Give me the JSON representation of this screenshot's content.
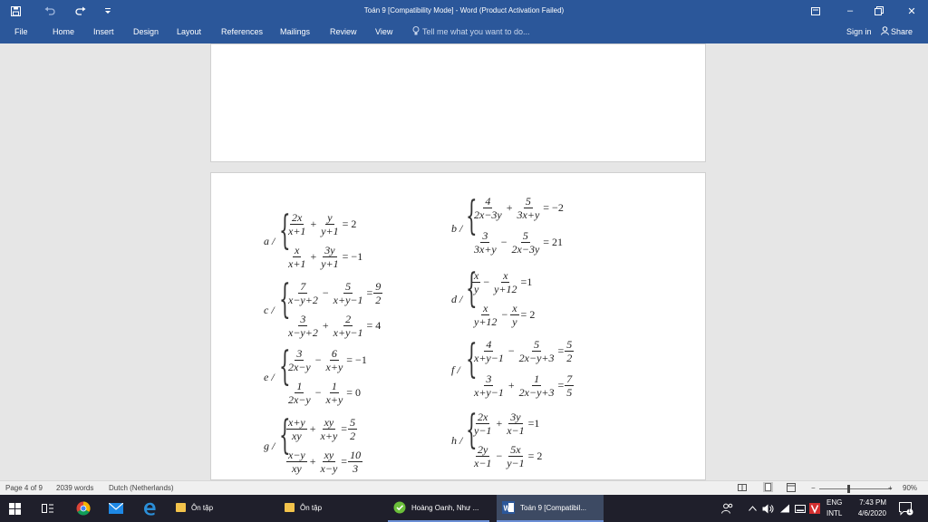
{
  "window": {
    "title": "Toán 9 [Compatibility Mode] - Word (Product Activation Failed)",
    "qat": {
      "save_icon": "save-icon",
      "undo_icon": "undo-icon",
      "redo_icon": "redo-icon",
      "customize_icon": "customize-icon"
    },
    "controls": {
      "ribbon_display": "⊡",
      "minimize": "–",
      "restore": "🗗",
      "close": "✕"
    }
  },
  "ribbon": {
    "tabs": [
      "File",
      "Home",
      "Insert",
      "Design",
      "Layout",
      "References",
      "Mailings",
      "Review",
      "View"
    ],
    "tell_me": "Tell me what you want to do...",
    "sign_in": "Sign in",
    "share": "Share"
  },
  "equations": {
    "a": {
      "label": "a /",
      "r1": {
        "f1n": "2x",
        "f1d": "x+1",
        "op": "+",
        "f2n": "y",
        "f2d": "y+1",
        "rhs": "= 2"
      },
      "r2": {
        "f1n": "x",
        "f1d": "x+1",
        "op": "+",
        "f2n": "3y",
        "f2d": "y+1",
        "rhs": "= −1"
      }
    },
    "b": {
      "label": "b /",
      "r1": {
        "f1n": "4",
        "f1d": "2x−3y",
        "op": "+",
        "f2n": "5",
        "f2d": "3x+y",
        "rhs": "= −2"
      },
      "r2": {
        "f1n": "3",
        "f1d": "3x+y",
        "op": "−",
        "f2n": "5",
        "f2d": "2x−3y",
        "rhs": "= 21"
      }
    },
    "c": {
      "label": "c /",
      "r1": {
        "f1n": "7",
        "f1d": "x−y+2",
        "op": "−",
        "f2n": "5",
        "f2d": "x+y−1",
        "rhs": "=",
        "rn": "9",
        "rd": "2"
      },
      "r2": {
        "f1n": "3",
        "f1d": "x−y+2",
        "op": "+",
        "f2n": "2",
        "f2d": "x+y−1",
        "rhs": "= 4"
      }
    },
    "d": {
      "label": "d /",
      "r1": {
        "f1n": "x",
        "f1d": "y",
        "op": "−",
        "f2n": "x",
        "f2d": "y+12",
        "rhs": "=1"
      },
      "r2": {
        "f1n": "x",
        "f1d": "y+12",
        "op": "−",
        "f2n": "x",
        "f2d": "y",
        "rhs": "= 2"
      }
    },
    "e": {
      "label": "e /",
      "r1": {
        "f1n": "3",
        "f1d": "2x−y",
        "op": "−",
        "f2n": "6",
        "f2d": "x+y",
        "rhs": "= −1"
      },
      "r2": {
        "f1n": "1",
        "f1d": "2x−y",
        "op": "−",
        "f2n": "1",
        "f2d": "x+y",
        "rhs": "= 0"
      }
    },
    "f": {
      "label": "f /",
      "r1": {
        "f1n": "4",
        "f1d": "x+y−1",
        "op": "−",
        "f2n": "5",
        "f2d": "2x−y+3",
        "rhs": "=",
        "rn": "5",
        "rd": "2"
      },
      "r2": {
        "f1n": "3",
        "f1d": "x+y−1",
        "op": "+",
        "f2n": "1",
        "f2d": "2x−y+3",
        "rhs": "=",
        "rn": "7",
        "rd": "5"
      }
    },
    "g": {
      "label": "g /",
      "r1": {
        "f1n": "x+y",
        "f1d": "xy",
        "op": "+",
        "f2n": "xy",
        "f2d": "x+y",
        "rhs": "=",
        "rn": "5",
        "rd": "2"
      },
      "r2": {
        "f1n": "x−y",
        "f1d": "xy",
        "op": "+",
        "f2n": "xy",
        "f2d": "x−y",
        "rhs": "=",
        "rn": "10",
        "rd": "3"
      }
    },
    "h": {
      "label": "h /",
      "r1": {
        "f1n": "2x",
        "f1d": "y−1",
        "op": "+",
        "f2n": "3y",
        "f2d": "x−1",
        "rhs": "=1"
      },
      "r2": {
        "f1n": "2y",
        "f1d": "x−1",
        "op": "−",
        "f2n": "5x",
        "f2d": "y−1",
        "rhs": "= 2"
      }
    }
  },
  "status": {
    "page": "Page 4 of 9",
    "words": "2039 words",
    "language": "Dutch (Netherlands)",
    "zoom": "90%",
    "zoom_minus": "−",
    "zoom_plus": "+"
  },
  "taskbar": {
    "apps": [
      {
        "label": "Ôn tập"
      },
      {
        "label": "Ôn tập"
      },
      {
        "label": "Hoàng Oanh, Như ..."
      },
      {
        "label": "Toán 9 [Compatibil..."
      }
    ],
    "lang_top": "ENG",
    "lang_bottom": "INTL",
    "time": "7:43 PM",
    "date": "4/6/2020",
    "notification_count": "1"
  }
}
